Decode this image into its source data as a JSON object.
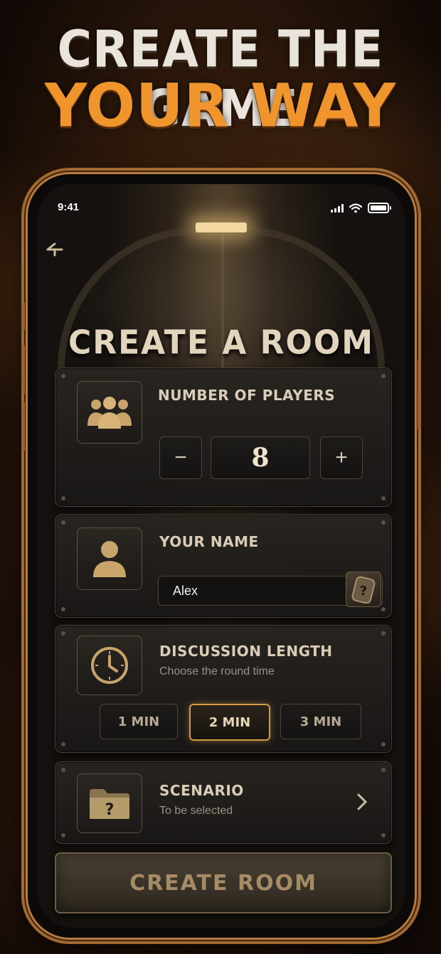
{
  "promo": {
    "line1": "CREATE THE GAME",
    "line2": "YOUR WAY"
  },
  "status_bar": {
    "time": "9:41"
  },
  "screen": {
    "title": "CREATE A ROOM"
  },
  "players": {
    "label": "NUMBER OF PLAYERS",
    "value": "8",
    "decrement": "−",
    "increment": "+"
  },
  "name": {
    "label": "YOUR NAME",
    "value": "Alex",
    "random_icon": "dogtag-question-icon"
  },
  "discussion": {
    "label": "DISCUSSION LENGTH",
    "subtitle": "Choose the round time",
    "options": [
      "1 MIN",
      "2 MIN",
      "3 MIN"
    ],
    "selected": "2 MIN"
  },
  "scenario": {
    "label": "SCENARIO",
    "subtitle": "To be selected"
  },
  "create_button": {
    "label": "CREATE ROOM"
  },
  "colors": {
    "accent_orange": "#f0952c",
    "selected_border": "#d59a44",
    "icon_gold": "#c8a46a"
  }
}
